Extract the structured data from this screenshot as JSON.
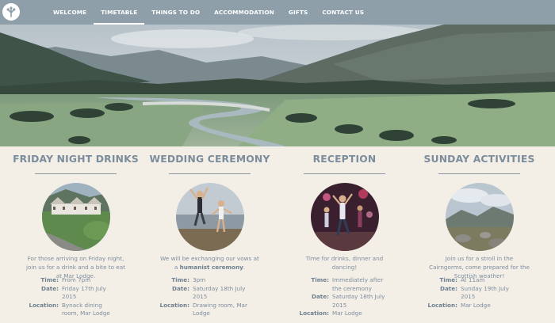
{
  "nav": {
    "items": [
      {
        "label": "WELCOME"
      },
      {
        "label": "TIMETABLE"
      },
      {
        "label": "THINGS TO DO"
      },
      {
        "label": "ACCOMMODATION"
      },
      {
        "label": "GIFTS"
      },
      {
        "label": "CONTACT US"
      }
    ],
    "active": "TIMETABLE"
  },
  "colors": {
    "nav_bg": "#8e9fa9",
    "page_bg": "#f3efe6",
    "heading": "#7b8c9c",
    "text": "#7d8da0"
  },
  "events": [
    {
      "title": "FRIDAY NIGHT DRINKS",
      "desc": "For those arriving on Friday night, join us for a drink and a bite to eat at Mar Lodge.",
      "time_label": "Time:",
      "time": "From 7pm",
      "date_label": "Date:",
      "date": "Friday 17th July 2015",
      "location_label": "Location:",
      "location": "Bynack dining room, Mar Lodge"
    },
    {
      "title": "WEDDING CEREMONY",
      "desc_pre": "We will be exchanging our vows at a ",
      "desc_bold": "humanist ceremony",
      "desc_post": ".",
      "time_label": "Time:",
      "time": "3pm",
      "date_label": "Date:",
      "date": "Saturday 18th July 2015",
      "location_label": "Location:",
      "location": "Drawing room, Mar Lodge"
    },
    {
      "title": "RECEPTION",
      "desc": "Time for drinks, dinner and dancing!",
      "time_label": "Time:",
      "time": "Immediately after the ceremony",
      "date_label": "Date:",
      "date": "Saturday 18th July 2015",
      "location_label": "Location:",
      "location": "Mar Lodge"
    },
    {
      "title": "SUNDAY ACTIVITIES",
      "desc": "Join us for a stroll in the Cairngorms, come prepared for the Scottish weather!",
      "time_label": "Time:",
      "time": "At 11am",
      "date_label": "Date:",
      "date": "Sunday 19th July 2015",
      "location_label": "Location:",
      "location": "Mar Lodge"
    }
  ]
}
